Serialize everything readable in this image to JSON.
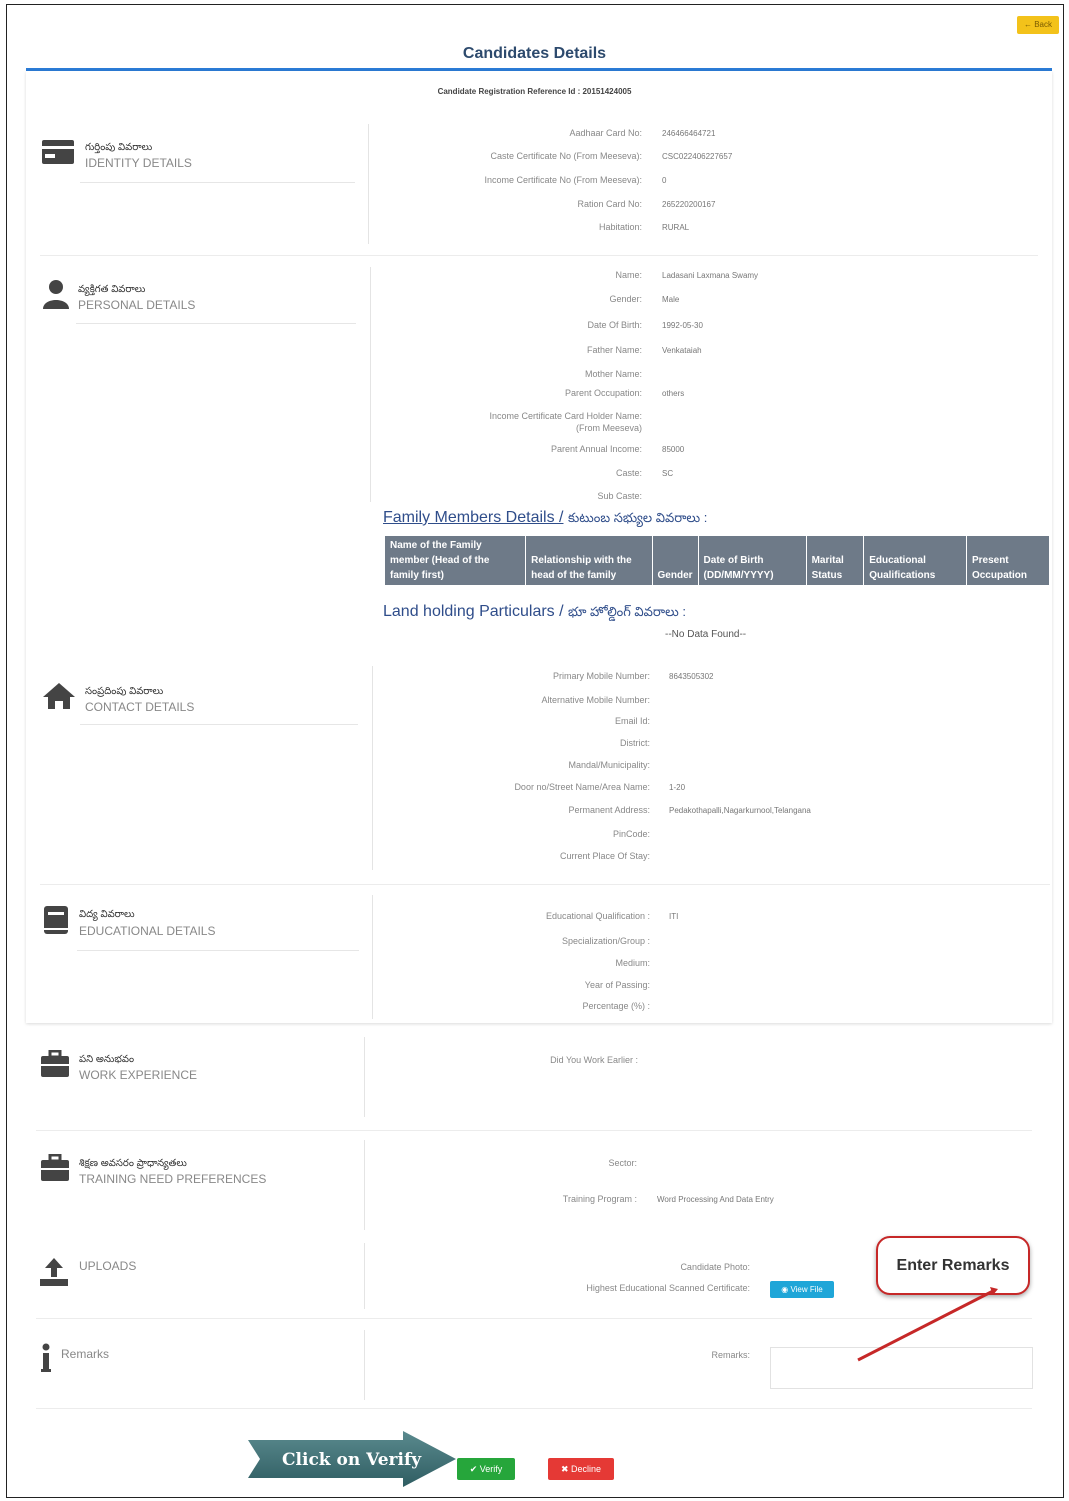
{
  "header": {
    "back_label": "← Back",
    "title": "Candidates Details",
    "reference": "Candidate Registration Reference Id : 20151424005"
  },
  "identity": {
    "title_te": "గుర్తింపు వివరాలు",
    "title_en": "IDENTITY DETAILS",
    "fields": [
      {
        "label": "Aadhaar Card No:",
        "value": "246466464721"
      },
      {
        "label": "Caste Certificate No (From Meeseva):",
        "value": "CSC022406227657"
      },
      {
        "label": "Income Certificate No (From Meeseva):",
        "value": "0"
      },
      {
        "label": "Ration Card No:",
        "value": "265220200167"
      },
      {
        "label": "Habitation:",
        "value": "RURAL"
      }
    ]
  },
  "personal": {
    "title_te": "వ్యక్తిగత వివరాలు",
    "title_en": "PERSONAL DETAILS",
    "fields": [
      {
        "label": "Name:",
        "value": "Ladasani Laxmana Swamy"
      },
      {
        "label": "Gender:",
        "value": "Male"
      },
      {
        "label": "Date Of Birth:",
        "value": "1992-05-30"
      },
      {
        "label": "Father Name:",
        "value": "Venkataiah"
      },
      {
        "label": "Mother Name:",
        "value": ""
      },
      {
        "label": "Parent Occupation:",
        "value": "others"
      },
      {
        "label": "Income Certificate Card Holder Name:",
        "value": ""
      },
      {
        "label": "(From Meeseva)",
        "value": ""
      },
      {
        "label": "Parent Annual Income:",
        "value": "85000"
      },
      {
        "label": "Caste:",
        "value": "SC"
      },
      {
        "label": "Sub Caste:",
        "value": ""
      }
    ]
  },
  "family": {
    "title": "Family Members Details /",
    "title_te": "కుటుంబ సభ్యుల వివరాలు :",
    "columns": [
      "Name of the Family member (Head of the family first)",
      "Relationship with the head of the family",
      "Gender",
      "Date of Birth (DD/MM/YYYY)",
      "Marital Status",
      "Educational Qualifications",
      "Present Occupation"
    ]
  },
  "land": {
    "title": "Land holding Particulars /",
    "title_te": "భూ హోల్డింగ్ వివరాలు :",
    "no_data": "--No Data Found--"
  },
  "contact": {
    "title_te": "సంప్రదింపు వివరాలు",
    "title_en": "CONTACT DETAILS",
    "fields": [
      {
        "label": "Primary Mobile Number:",
        "value": "8643505302"
      },
      {
        "label": "Alternative Mobile Number:",
        "value": ""
      },
      {
        "label": "Email Id:",
        "value": ""
      },
      {
        "label": "District:",
        "value": ""
      },
      {
        "label": "Mandal/Municipality:",
        "value": ""
      },
      {
        "label": "Door no/Street Name/Area Name:",
        "value": "1-20"
      },
      {
        "label": "Permanent Address:",
        "value": "Pedakothapalli,Nagarkurnool,Telangana"
      },
      {
        "label": "PinCode:",
        "value": ""
      },
      {
        "label": "Current Place Of Stay:",
        "value": ""
      }
    ]
  },
  "education": {
    "title_te": "విద్య వివరాలు",
    "title_en": "EDUCATIONAL DETAILS",
    "fields": [
      {
        "label": "Educational Qualification :",
        "value": "ITI"
      },
      {
        "label": "Specialization/Group :",
        "value": ""
      },
      {
        "label": "Medium:",
        "value": ""
      },
      {
        "label": "Year of Passing:",
        "value": ""
      },
      {
        "label": "Percentage (%) :",
        "value": ""
      }
    ]
  },
  "work": {
    "title_te": "పని అనుభవం",
    "title_en": "WORK EXPERIENCE",
    "label": "Did You Work Earlier :"
  },
  "training": {
    "title_te": "శిక్షణ అవసరం ప్రాధాన్యతలు",
    "title_en": "TRAINING NEED PREFERENCES",
    "sector_label": "Sector:",
    "program_label": "Training Program :",
    "program_value": "Word Processing And Data Entry"
  },
  "uploads": {
    "title_en": "UPLOADS",
    "photo_label": "Candidate Photo:",
    "cert_label": "Highest Educational Scanned Certificate:",
    "view_file": "View File"
  },
  "remarks": {
    "title_en": "Remarks",
    "label": "Remarks:"
  },
  "actions": {
    "verify": "✔ Verify",
    "decline": "✖ Decline"
  },
  "annotations": {
    "enter_remarks": "Enter Remarks",
    "click_verify": "Click on Verify",
    "arrow_color": "#c62828",
    "callout_arrow_color": "#3d6e72"
  }
}
